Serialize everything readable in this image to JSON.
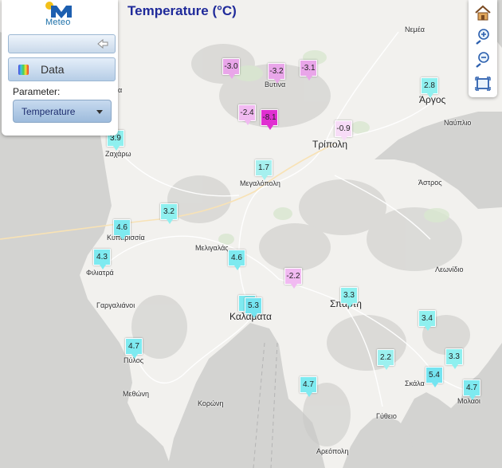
{
  "header": {
    "title": "Temperature (°C)"
  },
  "panel": {
    "logo_text": "Meteo",
    "data_label": "Data",
    "parameter_label": "Parameter:",
    "parameter_value": "Temperature"
  },
  "tools": [
    "home-icon",
    "zoom-in-icon",
    "zoom-out-icon",
    "fullscreen-icon"
  ],
  "places": [
    {
      "name": "Νεμέα",
      "icon": "town"
    },
    {
      "name": "Άργος",
      "icon": "city"
    },
    {
      "name": "Ναύπλιο",
      "icon": "town"
    },
    {
      "name": "Βυτίνα",
      "icon": "town"
    },
    {
      "name": "Τρίπολη",
      "icon": "city"
    },
    {
      "name": "Μεγαλόπολη",
      "icon": "town"
    },
    {
      "name": "Άστρος",
      "icon": "town"
    },
    {
      "name": "Ζαχάρω",
      "icon": "town"
    },
    {
      "name": "Κυπαρισσία",
      "icon": "town"
    },
    {
      "name": "Φιλιατρά",
      "icon": "town"
    },
    {
      "name": "Μελιγαλάς",
      "icon": "town"
    },
    {
      "name": "Λεωνίδιο",
      "icon": "town"
    },
    {
      "name": "Γαργαλιάνοι",
      "icon": "town"
    },
    {
      "name": "Καλαμάτα",
      "icon": "city"
    },
    {
      "name": "Σπάρτη",
      "icon": "city"
    },
    {
      "name": "Πύλος",
      "icon": "town"
    },
    {
      "name": "Μεθώνη",
      "icon": "town"
    },
    {
      "name": "Κορώνη",
      "icon": "town"
    },
    {
      "name": "Σκάλα",
      "icon": "town"
    },
    {
      "name": "Μολάοι",
      "icon": "town"
    },
    {
      "name": "Γύθειο",
      "icon": "town"
    },
    {
      "name": "Αρεόπολη",
      "icon": "town"
    },
    {
      "name": "ια",
      "icon": "town"
    }
  ],
  "stations": [
    {
      "value": "-3.0",
      "color": "#e9a6e9"
    },
    {
      "value": "-3.2",
      "color": "#e9a6e9"
    },
    {
      "value": "-3.1",
      "color": "#e9a6e9"
    },
    {
      "value": "2.8",
      "color": "#8ff0ef"
    },
    {
      "value": "-2.4",
      "color": "#f1baf1"
    },
    {
      "value": "-8.1",
      "color": "#e02fd1"
    },
    {
      "value": "-0.9",
      "color": "#f7dcf7"
    },
    {
      "value": "3.9",
      "color": "#8ff0ef"
    },
    {
      "value": "1.7",
      "color": "#a6f0ef"
    },
    {
      "value": "3.2",
      "color": "#8ff0ef"
    },
    {
      "value": "4.6",
      "color": "#7eeaf0"
    },
    {
      "value": "4.3",
      "color": "#7eeaf0"
    },
    {
      "value": "4.6",
      "color": "#7eeaf0"
    },
    {
      "value": "-2.2",
      "color": "#f1baf1"
    },
    {
      "value": "3.3",
      "color": "#8ff0ef"
    },
    {
      "value": "5",
      "color": "#7eeaf0"
    },
    {
      "value": "5.3",
      "color": "#74e4f0"
    },
    {
      "value": "3.4",
      "color": "#8ff0ef"
    },
    {
      "value": "4.7",
      "color": "#7eeaf0"
    },
    {
      "value": "2.2",
      "color": "#9cf0ef"
    },
    {
      "value": "3.3",
      "color": "#8ff0ef"
    },
    {
      "value": "5.4",
      "color": "#74e4f0"
    },
    {
      "value": "4.7",
      "color": "#7eeaf0"
    },
    {
      "value": "4.7",
      "color": "#7eeaf0"
    }
  ]
}
